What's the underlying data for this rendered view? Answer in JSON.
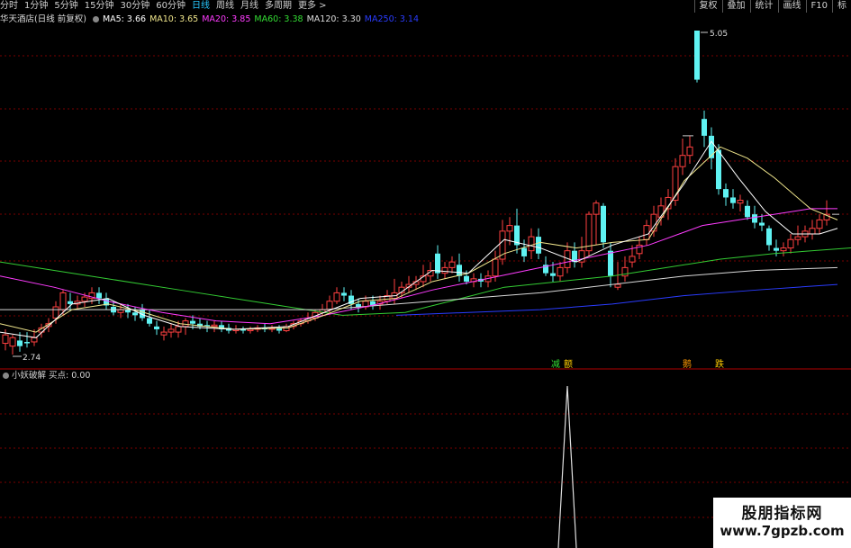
{
  "toolbar": {
    "periods": [
      "分时",
      "1分钟",
      "5分钟",
      "15分钟",
      "30分钟",
      "60分钟",
      "日线",
      "周线",
      "月线",
      "多周期",
      "更多 >"
    ],
    "active_index": 6,
    "right_buttons": [
      "复权",
      "叠加",
      "统计",
      "画线",
      "F10",
      "标"
    ]
  },
  "stock_title": "华天酒店(日线 前复权)",
  "ma": [
    {
      "label": "MA5: 3.66",
      "color": "#ffffff"
    },
    {
      "label": "MA10: 3.65",
      "color": "#f0e68c"
    },
    {
      "label": "MA20: 3.85",
      "color": "#ff3cff"
    },
    {
      "label": "MA60: 3.38",
      "color": "#33dd33"
    },
    {
      "label": "MA120: 3.30",
      "color": "#dddddd"
    },
    {
      "label": "MA250: 3.14",
      "color": "#2a3cff"
    }
  ],
  "price_labels": {
    "high": "5.05",
    "low": "2.74"
  },
  "signals": [
    {
      "text": "减",
      "color": "#33dd33"
    },
    {
      "text": "额",
      "color": "#ffcc00"
    },
    {
      "text": "鹅",
      "color": "#ff9900"
    },
    {
      "text": "跌",
      "color": "#ffcc00"
    }
  ],
  "indicator": {
    "name": "小妖破解",
    "value": "买点: 0.00"
  },
  "watermark": {
    "line1": "股朋指标网",
    "line2": "www.7gpzb.com"
  },
  "colors": {
    "up": "#ff4444",
    "down": "#5ff",
    "grid": "#8b0000"
  },
  "chart_data": {
    "type": "candlestick",
    "description": "daily candles, price range 2.74–5.05",
    "high": 5.05,
    "low": 2.74
  }
}
